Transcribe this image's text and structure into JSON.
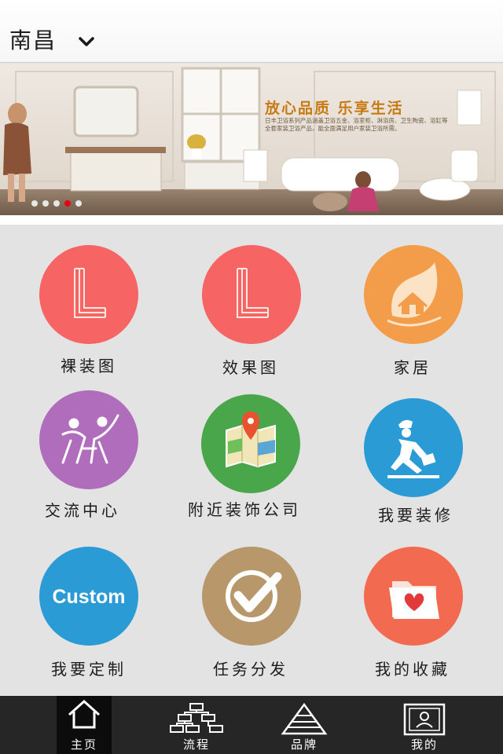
{
  "header": {
    "city": "南昌",
    "dropdown_icon": "chevron-down-icon"
  },
  "banner": {
    "slogan": "放心品质  乐享生活",
    "subtext": "日丰卫浴系列产品涵盖卫浴五金、浴室柜、淋浴房、卫生陶瓷、浴缸等全套家装卫浴产品，能全面满足用户家装卫浴所需。",
    "slides": 5,
    "active_slide": 4
  },
  "grid": {
    "items": [
      {
        "label": "裸装图",
        "icon": "l-logo-icon",
        "color": "#f76464"
      },
      {
        "label": "效果图",
        "icon": "l-logo-icon",
        "color": "#f76464"
      },
      {
        "label": "家居",
        "icon": "leaf-house-icon",
        "color": "#f39c4a"
      },
      {
        "label": "交流中心",
        "icon": "people-icon",
        "color": "#b06dbb"
      },
      {
        "label": "附近装饰公司",
        "icon": "map-pin-icon",
        "color": "#4aa64a"
      },
      {
        "label": "我要装修",
        "icon": "worker-icon",
        "color": "#2b9bd6"
      },
      {
        "label": "我要定制",
        "icon": "custom-icon",
        "color": "#2b9bd6",
        "text": "Custom"
      },
      {
        "label": "任务分发",
        "icon": "check-icon",
        "color": "#b8976b"
      },
      {
        "label": "我的收藏",
        "icon": "folder-heart-icon",
        "color": "#f26b50"
      }
    ]
  },
  "tabbar": {
    "tabs": [
      {
        "label": "主页",
        "icon": "home-icon",
        "active": true
      },
      {
        "label": "流程",
        "icon": "flowchart-icon",
        "active": false
      },
      {
        "label": "品牌",
        "icon": "pyramid-icon",
        "active": false
      },
      {
        "label": "我的",
        "icon": "profile-icon",
        "active": false
      }
    ]
  }
}
